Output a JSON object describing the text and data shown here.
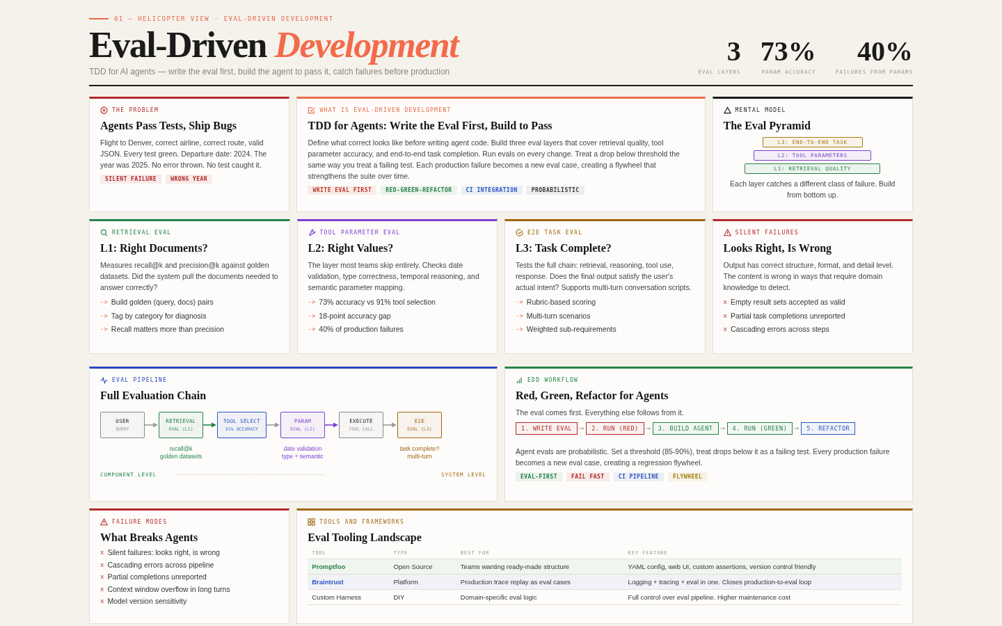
{
  "header": {
    "kicker": "01 — HELICOPTER VIEW · EVAL-DRIVEN DEVELOPMENT",
    "title": "Eval-Driven",
    "title_accent": "Development",
    "subtitle": "TDD for AI agents — write the eval first, build the agent to pass it, catch failures before production",
    "stats": [
      {
        "value": "3",
        "label": "EVAL LAYERS"
      },
      {
        "value": "73%",
        "label": "PARAM ACCURACY"
      },
      {
        "value": "40%",
        "label": "FAILURES FROM PARAMS"
      }
    ]
  },
  "rows": [
    [
      {
        "kind": "text",
        "color": "#b22a2a",
        "kicker": "THE PROBLEM",
        "title": "Agents Pass Tests, Ship Bugs",
        "body": "Flight to Denver, correct airline, correct route, valid JSON. Every test green. Departure date: 2024. The year was 2025. No error thrown. No test caught it.",
        "tags": [
          {
            "label": "SILENT FAILURE",
            "color": "#b22a2a"
          },
          {
            "label": "WRONG YEAR",
            "color": "#b22a2a"
          }
        ]
      },
      {
        "kind": "text",
        "color": "#e8694a",
        "kicker": "WHAT IS EVAL-DRIVEN DEVELOPMENT",
        "title": "TDD for Agents: Write the Eval First, Build to Pass",
        "body": "Define what correct looks like before writing agent code. Build three eval layers that cover retrieval quality, tool parameter accuracy, and end-to-end task completion. Run evals on every change. Treat a drop below threshold the same way you treat a failing test. Each production failure becomes a new eval case, creating a flywheel that strengthens the suite over time.",
        "tags": [
          {
            "label": "WRITE EVAL FIRST",
            "color": "#c0392b"
          },
          {
            "label": "RED-GREEN-REFACTOR",
            "color": "#23834a"
          },
          {
            "label": "CI INTEGRATION",
            "color": "#2a55c4"
          },
          {
            "label": "PROBABILISTIC",
            "color": "#3a3a3a"
          }
        ]
      },
      {
        "kind": "pyramid",
        "color": "#1a1a1a",
        "kicker": "MENTAL MODEL",
        "title": "The Eval Pyramid",
        "levels": [
          {
            "label": "L3: END-TO-END TASK",
            "color": "#a57a10"
          },
          {
            "label": "L2: TOOL PARAMETERS",
            "color": "#7a3fd0"
          },
          {
            "label": "L1: RETRIEVAL QUALITY",
            "color": "#23834a"
          }
        ],
        "body": "Each layer catches a different class of failure. Build from bottom up."
      }
    ],
    [
      {
        "kind": "list",
        "color": "#23834a",
        "kicker": "RETRIEVAL EVAL",
        "title": "L1: Right Documents?",
        "body": "Measures recall@k and precision@k against golden datasets. Did the system pull the documents needed to answer correctly?",
        "items": [
          {
            "marker": "->",
            "text": "Build golden (query, docs) pairs"
          },
          {
            "marker": "->",
            "text": "Tag by category for diagnosis"
          },
          {
            "marker": "->",
            "text": "Recall matters more than precision"
          }
        ]
      },
      {
        "kind": "list",
        "color": "#7a3fd0",
        "kicker": "TOOL PARAMETER EVAL",
        "title": "L2: Right Values?",
        "body": "The layer most teams skip entirely. Checks date validation, type correctness, temporal reasoning, and semantic parameter mapping.",
        "items": [
          {
            "marker": "->",
            "text": "73% accuracy vs 91% tool selection"
          },
          {
            "marker": "->",
            "text": "18-point accuracy gap"
          },
          {
            "marker": "->",
            "text": "40% of production failures"
          }
        ]
      },
      {
        "kind": "list",
        "color": "#a0650f",
        "kicker": "E2E TASK EVAL",
        "title": "L3: Task Complete?",
        "body": "Tests the full chain: retrieval, reasoning, tool use, response. Does the final output satisfy the user's actual intent? Supports multi-turn conversation scripts.",
        "items": [
          {
            "marker": "->",
            "text": "Rubric-based scoring"
          },
          {
            "marker": "->",
            "text": "Multi-turn scenarios"
          },
          {
            "marker": "->",
            "text": "Weighted sub-requirements"
          }
        ]
      },
      {
        "kind": "list",
        "color": "#b22a2a",
        "kicker": "SILENT FAILURES",
        "title": "Looks Right, Is Wrong",
        "body": "Output has correct structure, format, and detail level. The content is wrong in ways that require domain knowledge to detect.",
        "items": [
          {
            "marker": "x",
            "text": "Empty result sets accepted as valid"
          },
          {
            "marker": "x",
            "text": "Partial task completions unreported"
          },
          {
            "marker": "x",
            "text": "Cascading errors across steps"
          }
        ]
      }
    ],
    [
      {
        "kind": "pipeline",
        "color": "#2a45c4",
        "kicker": "EVAL PIPELINE",
        "title": "Full Evaluation Chain",
        "nodes": [
          {
            "title": "USER",
            "sub": "QUERY",
            "color": "#8a8a8a",
            "link_active": false
          },
          {
            "title": "RETRIEVAL",
            "sub": "EVAL (L1)",
            "color": "#23834a",
            "link_active": true,
            "notes": [
              "recall@k",
              "golden datasets"
            ]
          },
          {
            "title": "TOOL SELECT",
            "sub": "91% ACCURACY",
            "color": "#2a55c4",
            "link_active": false
          },
          {
            "title": "PARAM",
            "sub": "EVAL (L2)",
            "color": "#7a3fd0",
            "link_active": true,
            "notes": [
              "date validation",
              "type + semantic"
            ]
          },
          {
            "title": "EXECUTE",
            "sub": "TOOL CALL",
            "color": "#8a8a8a",
            "link_active": false
          },
          {
            "title": "E2E",
            "sub": "EVAL (L3)",
            "color": "#a0650f",
            "notes": [
              "task complete?",
              "multi-turn"
            ]
          }
        ],
        "footer_left": "COMPONENT LEVEL",
        "footer_right": "SYSTEM LEVEL"
      },
      {
        "kind": "workflow",
        "color": "#23834a",
        "kicker": "EDD WORKFLOW",
        "title": "Red, Green, Refactor for Agents",
        "intro": "The eval comes first. Everything else follows from it.",
        "steps": [
          {
            "label": "1. WRITE EVAL",
            "color": "#b22a2a"
          },
          {
            "label": "2. RUN (RED)",
            "color": "#b22a2a"
          },
          {
            "label": "3. BUILD AGENT",
            "color": "#23834a"
          },
          {
            "label": "4. RUN (GREEN)",
            "color": "#23834a"
          },
          {
            "label": "5. REFACTOR",
            "color": "#2a55c4"
          }
        ],
        "body": "Agent evals are probabilistic. Set a threshold (85-90%), treat drops below it as a failing test. Every production failure becomes a new eval case, creating a regression flywheel.",
        "tags": [
          {
            "label": "EVAL-FIRST",
            "color": "#23834a"
          },
          {
            "label": "FAIL FAST",
            "color": "#b22a2a"
          },
          {
            "label": "CI PIPELINE",
            "color": "#2a55c4"
          },
          {
            "label": "FLYWHEEL",
            "color": "#a57a10"
          }
        ]
      }
    ],
    [
      {
        "kind": "list",
        "color": "#b22a2a",
        "kicker": "FAILURE MODES",
        "title": "What Breaks Agents",
        "items": [
          {
            "marker": "x",
            "text": "Silent failures: looks right, is wrong"
          },
          {
            "marker": "x",
            "text": "Cascading errors across pipeline"
          },
          {
            "marker": "x",
            "text": "Partial completions unreported"
          },
          {
            "marker": "x",
            "text": "Context window overflow in long turns"
          },
          {
            "marker": "x",
            "text": "Model version sensitivity"
          }
        ]
      },
      {
        "kind": "table",
        "color": "#a0650f",
        "kicker": "TOOLS AND FRAMEWORKS",
        "title": "Eval Tooling Landscape",
        "columns": [
          "TOOL",
          "TYPE",
          "BEST FOR",
          "KEY FEATURE"
        ],
        "table_rows": [
          {
            "cells": [
              "Promptfoo",
              "Open Source",
              "Teams wanting ready-made structure",
              "YAML config, web UI, custom assertions, version control friendly"
            ],
            "color": "#23834a"
          },
          {
            "cells": [
              "Braintrust",
              "Platform",
              "Production trace replay as eval cases",
              "Logging + tracing + eval in one. Closes production-to-eval loop"
            ],
            "color": "#2a55c4"
          },
          {
            "cells": [
              "Custom Harness",
              "DIY",
              "Domain-specific eval logic",
              "Full control over eval pipeline. Higher maintenance cost"
            ]
          }
        ]
      }
    ]
  ]
}
